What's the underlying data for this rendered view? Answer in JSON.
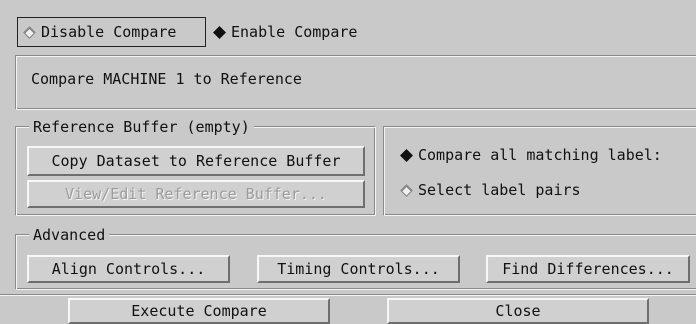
{
  "compare_mode": {
    "disable_label": "Disable Compare",
    "enable_label": "Enable Compare",
    "selected": "enable"
  },
  "description": "Compare MACHINE 1 to Reference",
  "reference_buffer": {
    "title": "Reference Buffer (empty)",
    "copy_button": "Copy Dataset to Reference Buffer",
    "view_edit_button": "View/Edit Reference Buffer..."
  },
  "label_mode": {
    "all_matching": "Compare all matching label:",
    "select_pairs": "Select label pairs",
    "selected": "all_matching"
  },
  "advanced": {
    "title": "Advanced",
    "align_button": "Align Controls...",
    "timing_button": "Timing Controls...",
    "find_button": "Find Differences..."
  },
  "footer": {
    "execute_button": "Execute Compare",
    "close_button": "Close"
  }
}
